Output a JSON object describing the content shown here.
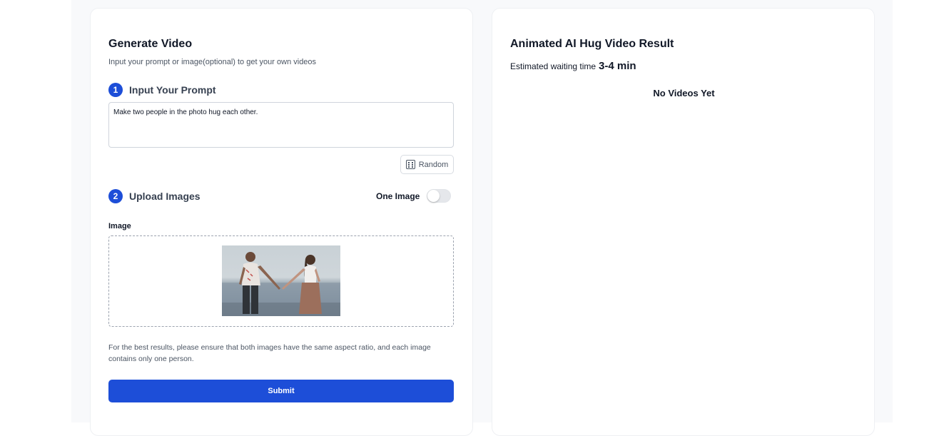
{
  "generate": {
    "title": "Generate Video",
    "subtitle": "Input your prompt or image(optional) to get your own videos",
    "step1": {
      "number": "1",
      "label": "Input Your Prompt"
    },
    "prompt_value": "Make two people in the photo hug each other.",
    "random_label": "Random",
    "step2": {
      "number": "2",
      "label": "Upload Images"
    },
    "toggle": {
      "label": "One Image",
      "on": false
    },
    "image_label": "Image",
    "note": "For the best results, please ensure that both images have the same aspect ratio, and each image contains only one person.",
    "submit_label": "Submit"
  },
  "result": {
    "title": "Animated AI Hug Video Result",
    "waiting_label": "Estimated waiting time",
    "waiting_value": "3-4 min",
    "empty_text": "No Videos Yet"
  },
  "colors": {
    "primary": "#1d4ed8",
    "background": "#f8f9fb",
    "card": "#ffffff"
  }
}
